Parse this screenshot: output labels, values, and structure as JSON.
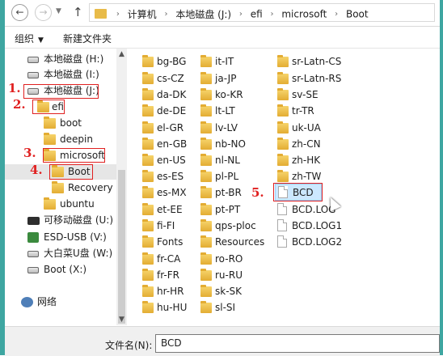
{
  "address_bar": {
    "breadcrumbs": [
      "计算机",
      "本地磁盘 (J:)",
      "efi",
      "microsoft",
      "Boot"
    ]
  },
  "toolbar": {
    "organize_label": "组织",
    "new_folder_label": "新建文件夹"
  },
  "nav_pane": {
    "items": [
      {
        "label": "本地磁盘 (H:)",
        "icon": "drive-icon"
      },
      {
        "label": "本地磁盘 (I:)",
        "icon": "drive-icon"
      },
      {
        "label": "本地磁盘 (J:)",
        "icon": "drive-icon"
      },
      {
        "label": "efi",
        "icon": "folder-icon"
      },
      {
        "label": "boot",
        "icon": "folder-icon"
      },
      {
        "label": "deepin",
        "icon": "folder-icon"
      },
      {
        "label": "microsoft",
        "icon": "folder-icon"
      },
      {
        "label": "Boot",
        "icon": "folder-icon",
        "selected": true
      },
      {
        "label": "Recovery",
        "icon": "folder-icon"
      },
      {
        "label": "ubuntu",
        "icon": "folder-icon"
      },
      {
        "label": "可移动磁盘 (U:)",
        "icon": "usb-drive-icon"
      },
      {
        "label": "ESD-USB (V:)",
        "icon": "usb-drive-icon"
      },
      {
        "label": "大白菜U盘 (W:)",
        "icon": "drive-icon"
      },
      {
        "label": "Boot (X:)",
        "icon": "drive-icon"
      },
      {
        "label": "网络",
        "icon": "network-icon"
      }
    ]
  },
  "files": {
    "col1": [
      "bg-BG",
      "cs-CZ",
      "da-DK",
      "de-DE",
      "el-GR",
      "en-GB",
      "en-US",
      "es-ES",
      "es-MX",
      "et-EE",
      "fi-FI",
      "Fonts",
      "fr-CA",
      "fr-FR",
      "hr-HR",
      "hu-HU"
    ],
    "col2": [
      "it-IT",
      "ja-JP",
      "ko-KR",
      "lt-LT",
      "lv-LV",
      "nb-NO",
      "nl-NL",
      "pl-PL",
      "pt-BR",
      "pt-PT",
      "qps-ploc",
      "Resources",
      "ro-RO",
      "ru-RU",
      "sk-SK",
      "sl-SI"
    ],
    "col3_folders": [
      "sr-Latn-CS",
      "sr-Latn-RS",
      "sv-SE",
      "tr-TR",
      "uk-UA",
      "zh-CN",
      "zh-HK",
      "zh-TW"
    ],
    "col3_files": [
      "BCD",
      "BCD.LOG",
      "BCD.LOG1",
      "BCD.LOG2"
    ]
  },
  "bottom": {
    "filename_label": "文件名(N):",
    "filename_value": "BCD"
  },
  "annotations": [
    "1.",
    "2.",
    "3.",
    "4.",
    "5."
  ],
  "colors": {
    "annotation": "#e02020",
    "selection": "#cce8ff",
    "folder": "#e8bb49"
  }
}
